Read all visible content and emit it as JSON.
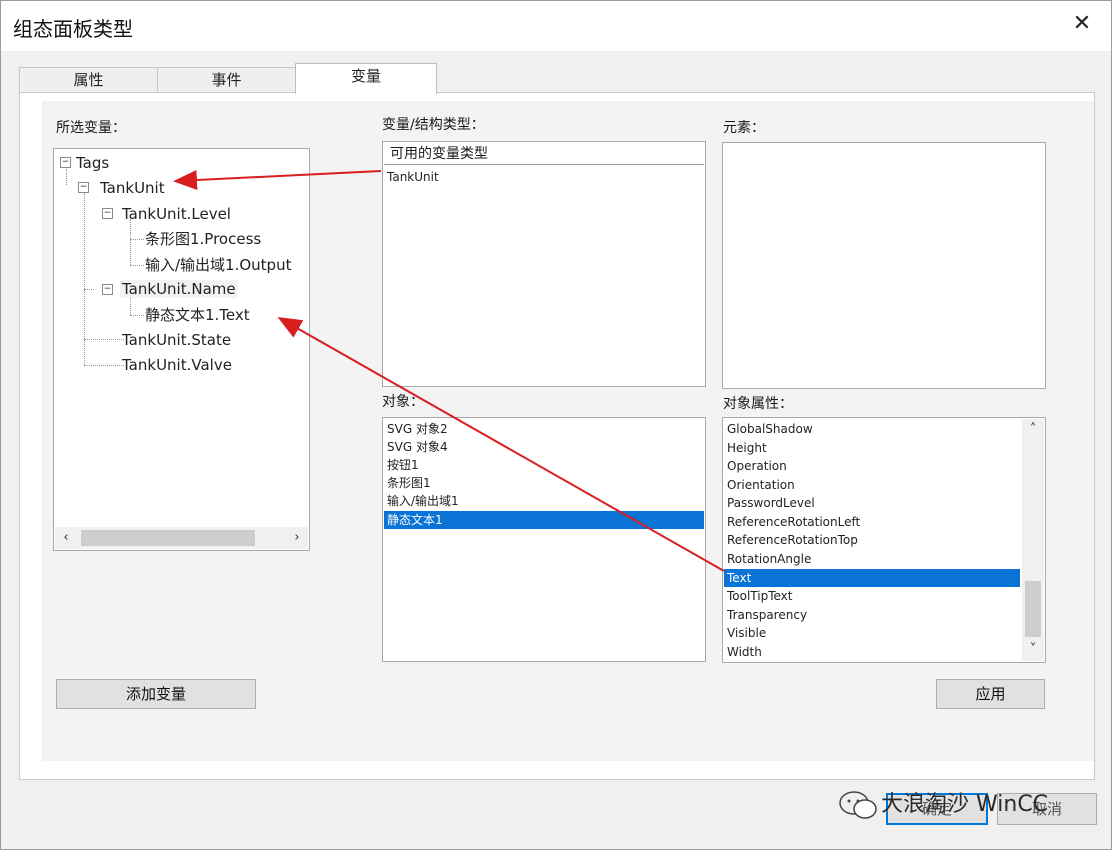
{
  "window": {
    "title": "组态面板类型",
    "close_glyph": "✕"
  },
  "tabs": [
    {
      "label": "属性",
      "active": false
    },
    {
      "label": "事件",
      "active": false
    },
    {
      "label": "变量",
      "active": true
    }
  ],
  "selected_variables": {
    "label": "所选变量：",
    "tree": [
      {
        "label": "Tags",
        "toggle": "−"
      },
      {
        "label": "TankUnit",
        "toggle": "−"
      },
      {
        "label": "TankUnit.Level",
        "toggle": "−"
      },
      {
        "label": "条形图1.Process"
      },
      {
        "label": "输入/输出域1.Output"
      },
      {
        "label": "TankUnit.Name",
        "toggle": "−"
      },
      {
        "label": "静态文本1.Text"
      },
      {
        "label": "TankUnit.State"
      },
      {
        "label": "TankUnit.Valve"
      }
    ],
    "scroll_left": "‹",
    "scroll_right": "›"
  },
  "variable_struct_type": {
    "label": "变量/结构类型：",
    "header": "可用的变量类型",
    "items": [
      "TankUnit"
    ]
  },
  "elements": {
    "label": "元素："
  },
  "objects": {
    "label": "对象：",
    "items": [
      "SVG 对象2",
      "SVG 对象4",
      "按钮1",
      "条形图1",
      "输入/输出域1",
      "静态文本1"
    ],
    "selected_index": 5
  },
  "object_properties": {
    "label": "对象属性：",
    "items": [
      "GlobalShadow",
      "Height",
      "Operation",
      "Orientation",
      "PasswordLevel",
      "ReferenceRotationLeft",
      "ReferenceRotationTop",
      "RotationAngle",
      "Text",
      "ToolTipText",
      "Transparency",
      "Visible",
      "Width"
    ],
    "selected_index": 8,
    "scroll_up": "˄",
    "scroll_down": "˅"
  },
  "buttons": {
    "add_variable": "添加变量",
    "apply": "应用",
    "ok": "确定",
    "cancel": "取消"
  },
  "watermark": "大浪淘沙 WinCC",
  "colors": {
    "selection": "#0a73d6",
    "arrow": "#d81e1e"
  }
}
